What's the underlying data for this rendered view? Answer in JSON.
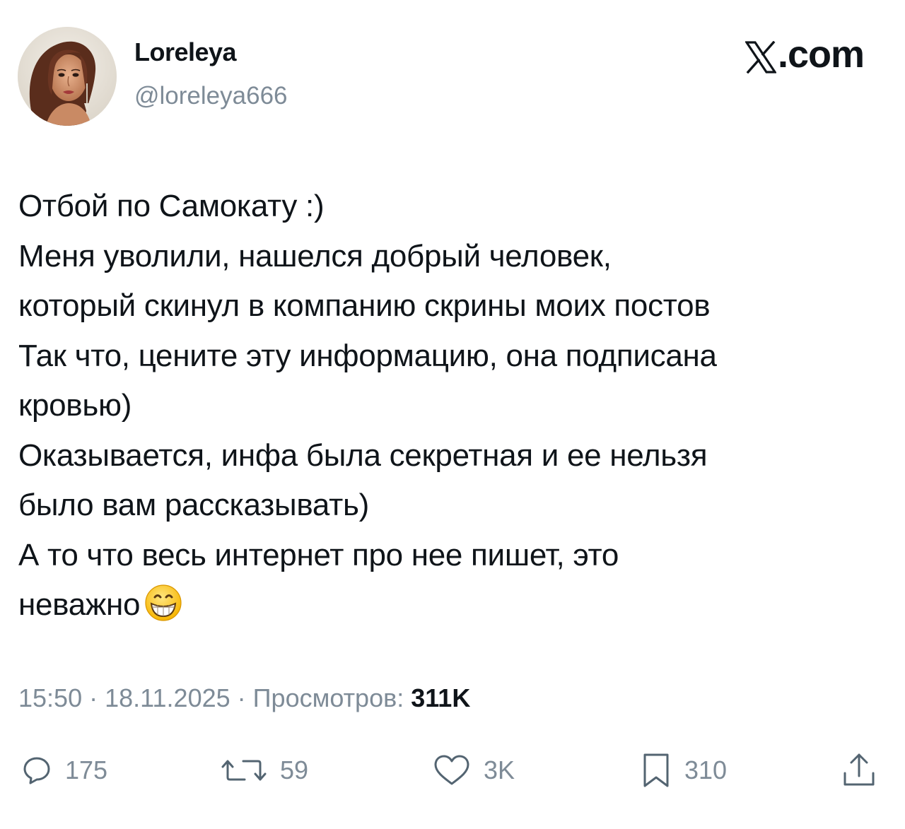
{
  "author": {
    "display_name": "Loreleya",
    "handle": "@loreleya666",
    "avatar_icon": "profile-avatar"
  },
  "brand": {
    "text": ".com",
    "icon": "x-logo-icon"
  },
  "tweet": {
    "lines": [
      "Отбой по Самокату :)",
      "Меня уволили, нашелся добрый человек,",
      "который скинул в компанию скрины моих постов",
      "Так что, цените эту информацию, она подписана",
      "кровью)",
      "Оказывается, инфа была секретная и ее нельзя",
      "было вам рассказывать)",
      "А то что весь интернет про нее пишет, это",
      "неважно"
    ],
    "emoji": "grinning-face-emoji"
  },
  "meta": {
    "time": "15:50",
    "date": "18.11.2025",
    "views_label": "Просмотров:",
    "views_count": "311K",
    "separator": "·"
  },
  "actions": {
    "replies": "175",
    "reposts": "59",
    "likes": "3K",
    "bookmarks": "310"
  },
  "colors": {
    "text": "#0f1419",
    "secondary": "#7e8b97",
    "background": "#ffffff"
  }
}
